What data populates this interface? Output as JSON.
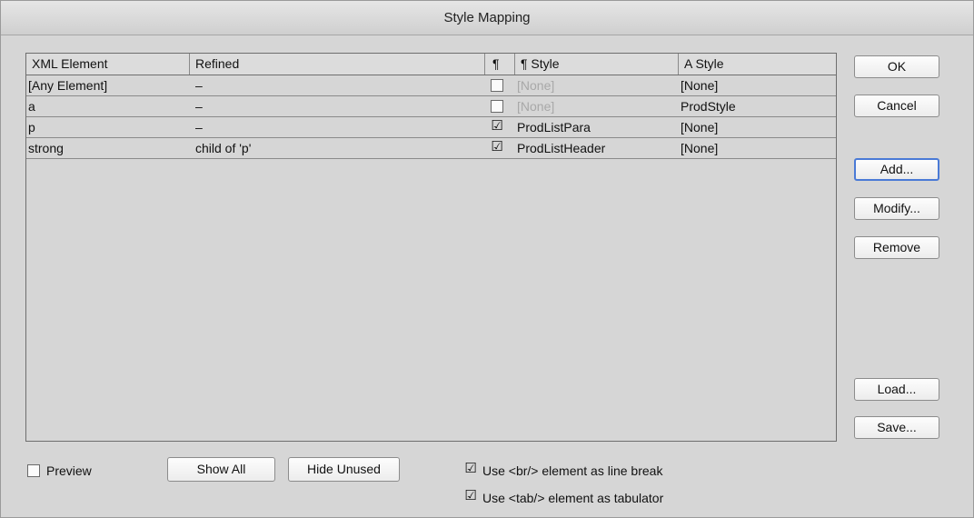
{
  "window": {
    "title": "Style Mapping"
  },
  "table": {
    "headers": {
      "xml_element": "XML Element",
      "refined": "Refined",
      "para_mark": "¶",
      "para_style": "¶  Style",
      "char_style": "A  Style"
    },
    "rows": [
      {
        "element": "[Any Element]",
        "refined": "–",
        "checked": "",
        "para_style": "[None]",
        "char_style": "[None]"
      },
      {
        "element": "a",
        "refined": "–",
        "checked": "",
        "para_style": "[None]",
        "char_style": "ProdStyle"
      },
      {
        "element": "p",
        "refined": "–",
        "checked": "☑",
        "para_style": "ProdListPara",
        "char_style": "[None]"
      },
      {
        "element": "strong",
        "refined": "child of 'p'",
        "checked": "☑",
        "para_style": "ProdListHeader",
        "char_style": "[None]"
      }
    ]
  },
  "buttons": {
    "ok": "OK",
    "cancel": "Cancel",
    "add": "Add...",
    "modify": "Modify...",
    "remove": "Remove",
    "load": "Load...",
    "save": "Save...",
    "show_all": "Show All",
    "hide_unused": "Hide Unused"
  },
  "options": {
    "preview_label": "Preview",
    "preview_checked": "",
    "br_label": "Use <br/> element as line break",
    "br_checked": "☑",
    "tab_label": "Use <tab/> element as tabulator",
    "tab_checked": "☑"
  }
}
